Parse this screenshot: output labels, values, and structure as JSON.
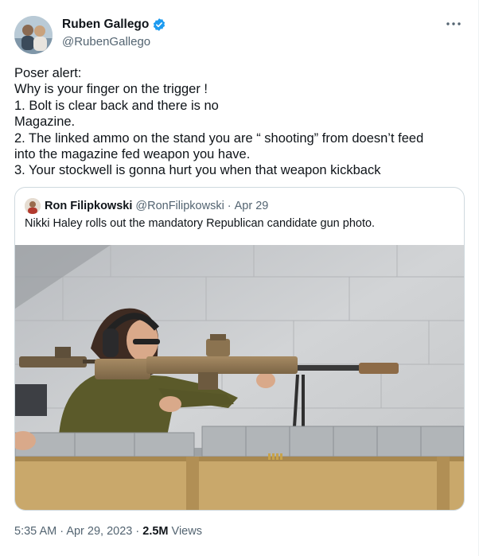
{
  "tweet": {
    "display_name": "Ruben Gallego",
    "handle": "@RubenGallego",
    "text_lines": [
      "Poser alert:",
      "Why is your finger on the trigger !",
      "1. Bolt is clear back and there is no",
      "Magazine.",
      "2. The linked ammo on the stand you are “ shooting” from doesn’t feed",
      "into the magazine fed weapon you have.",
      "3. Your stockwell is gonna hurt you when that weapon kickback"
    ],
    "time": "5:35 AM",
    "date": "Apr 29, 2023",
    "views_count": "2.5M",
    "views_label": "Views"
  },
  "quoted": {
    "display_name": "Ron Filipkowski",
    "handle": "@RonFilipkowski",
    "date": "Apr 29",
    "text": "Nikki Haley rolls out the mandatory Republican candidate gun photo."
  },
  "icons": {
    "verified": "verified-badge-icon",
    "more": "more-options-icon"
  },
  "colors": {
    "accent": "#1d9bf0",
    "text": "#0f1419",
    "secondary": "#536471",
    "border": "#cfd9de"
  }
}
